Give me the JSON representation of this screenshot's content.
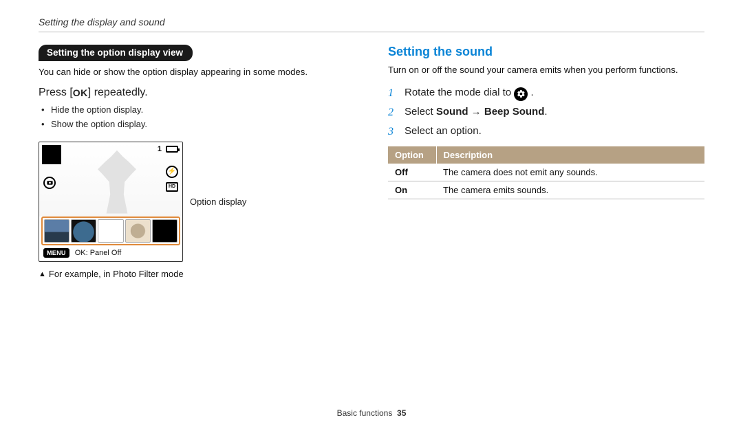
{
  "page_header": "Setting the display and sound",
  "left": {
    "pill": "Setting the option display view",
    "intro": "You can hide or show the option display appearing in some modes.",
    "instruction_prefix": "Press [",
    "instruction_key": "OK",
    "instruction_suffix": "] repeatedly.",
    "bullets": [
      "Hide the option display.",
      "Show the option display."
    ],
    "screenshot": {
      "top_right_number": "1",
      "menu_label": "MENU",
      "status_text": "OK: Panel Off",
      "flash_icon_text": "⚡",
      "hd_text": "HD"
    },
    "annotation": "Option display",
    "example": "For example, in Photo Filter mode"
  },
  "right": {
    "heading": "Setting the sound",
    "intro": "Turn on or off the sound your camera emits when you perform functions.",
    "steps": {
      "s1": "Rotate the mode dial to ",
      "s1_end": ".",
      "s2_pre": "Select ",
      "s2_b1": "Sound",
      "s2_arrow": " → ",
      "s2_b2": "Beep Sound",
      "s2_end": ".",
      "s3": "Select an option."
    },
    "table": {
      "head_option": "Option",
      "head_desc": "Description",
      "rows": [
        {
          "opt": "Off",
          "desc": "The camera does not emit any sounds."
        },
        {
          "opt": "On",
          "desc": "The camera emits sounds."
        }
      ]
    }
  },
  "footer": {
    "section": "Basic functions",
    "page": "35"
  }
}
